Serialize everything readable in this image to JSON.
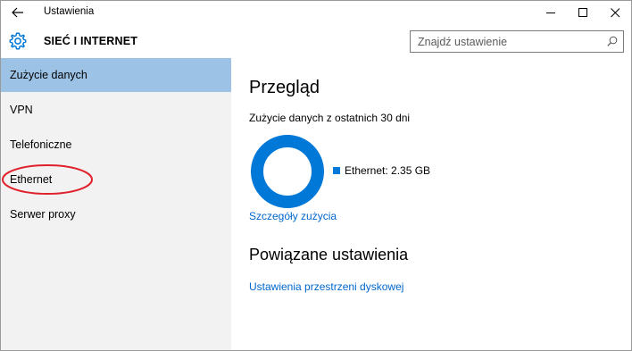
{
  "titlebar": {
    "app_title": "Ustawienia",
    "back_icon": "arrow-left-icon",
    "minimize_icon": "minimize-icon",
    "maximize_icon": "maximize-icon",
    "close_icon": "close-icon"
  },
  "header": {
    "icon": "gear-icon",
    "section_title": "SIEĆ I INTERNET",
    "search": {
      "placeholder": "Znajdź ustawienie",
      "value": "",
      "icon": "search-icon"
    }
  },
  "sidebar": {
    "items": [
      {
        "label": "Zużycie danych",
        "active": true
      },
      {
        "label": "VPN",
        "active": false
      },
      {
        "label": "Telefoniczne",
        "active": false
      },
      {
        "label": "Ethernet",
        "active": false,
        "highlighted": true
      },
      {
        "label": "Serwer proxy",
        "active": false
      }
    ],
    "active_color": "#9cc3e6",
    "annotation_color": "#e0202a"
  },
  "main": {
    "overview_title": "Przegląd",
    "usage_label": "Zużycie danych z ostatnich 30 dni",
    "usage": {
      "series": [
        {
          "name": "Ethernet",
          "value": 2.35,
          "unit": "GB",
          "share": 1.0
        }
      ],
      "legend_text": "Ethernet: 2.35 GB",
      "color": "#0078d7"
    },
    "details_link": "Szczegóły zużycia",
    "related_title": "Powiązane ustawienia",
    "storage_link": "Ustawienia przestrzeni dyskowej",
    "link_color": "#0066cc"
  }
}
